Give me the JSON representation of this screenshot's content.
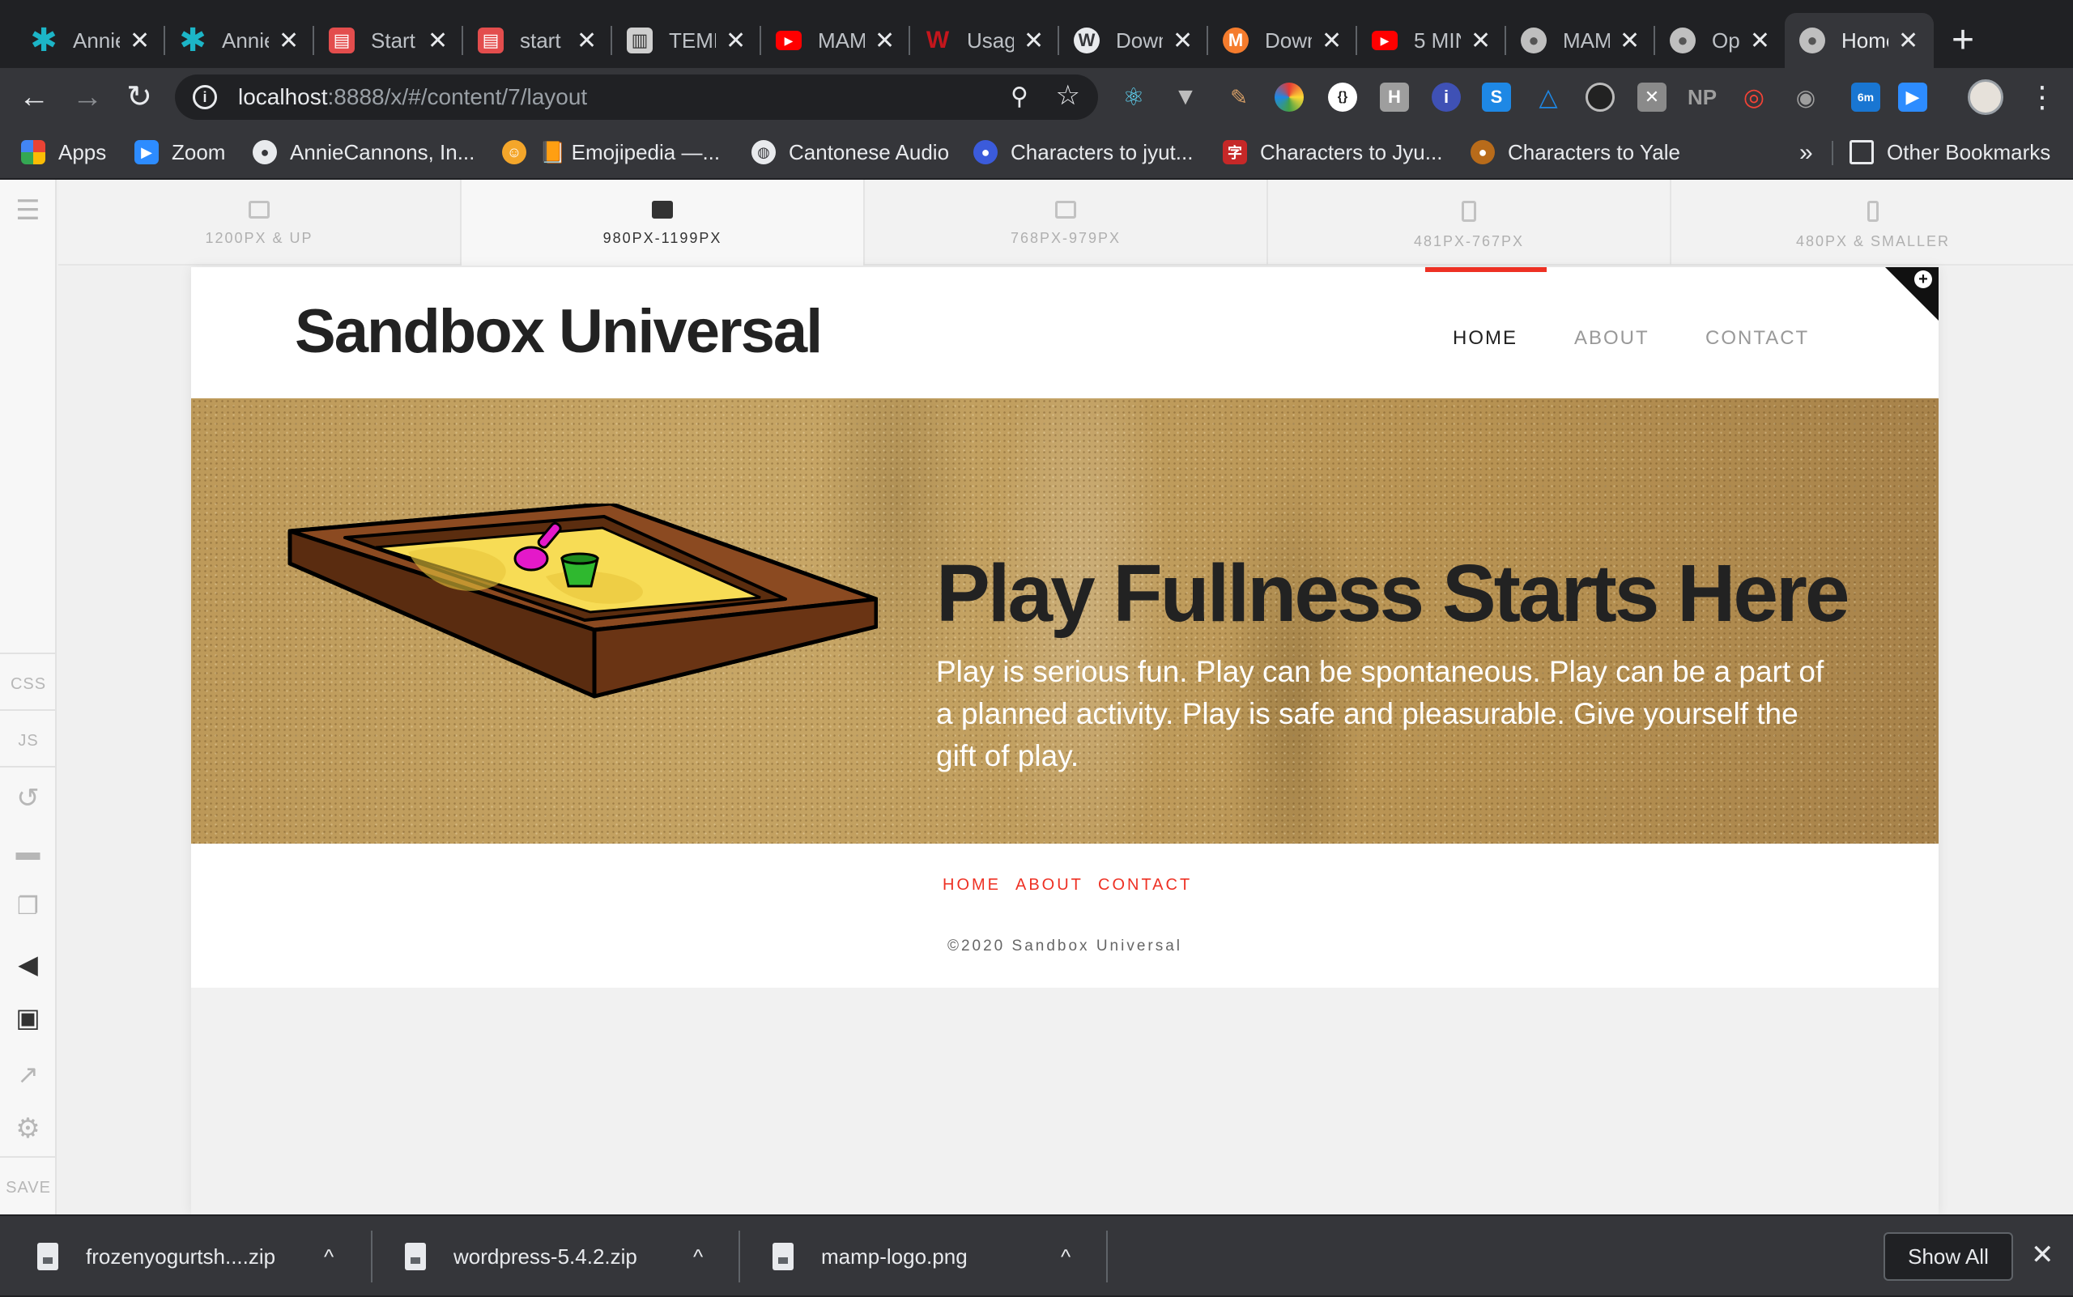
{
  "browser": {
    "tabs": [
      {
        "title": "Annie",
        "icon": "asterisk-icon",
        "color": "#1cb5c7"
      },
      {
        "title": "Annie",
        "icon": "asterisk-icon",
        "color": "#1cb5c7"
      },
      {
        "title": "Start",
        "icon": "clapper-icon",
        "color": "#e34d4d"
      },
      {
        "title": "start",
        "icon": "clapper-icon",
        "color": "#e34d4d"
      },
      {
        "title": "TEMP",
        "icon": "book-icon",
        "color": "#cfcfcf"
      },
      {
        "title": "MAMP",
        "icon": "youtube-icon",
        "color": "#ff0000"
      },
      {
        "title": "Usage",
        "icon": "w-icon",
        "color": "#c4161c"
      },
      {
        "title": "Down",
        "icon": "wordpress-icon",
        "color": "#e8eaed"
      },
      {
        "title": "Down",
        "icon": "m-icon",
        "color": "#f57c2d"
      },
      {
        "title": "5 MIN",
        "icon": "youtube-icon",
        "color": "#ff0000"
      },
      {
        "title": "MAMP",
        "icon": "elephant-icon",
        "color": "#bfbfbf"
      },
      {
        "title": "Option",
        "icon": "elephant-icon",
        "color": "#bfbfbf"
      },
      {
        "title": "Home",
        "icon": "elephant-icon",
        "color": "#bfbfbf"
      }
    ],
    "url_host": "localhost",
    "url_path": ":8888/x/#/content/7/layout",
    "bookmarks": [
      {
        "label": "Apps",
        "icon": "apps-grid-icon",
        "color": "#ea4335"
      },
      {
        "label": "Zoom",
        "icon": "zoom-icon",
        "color": "#2d8cff"
      },
      {
        "label": "AnnieCannons, In...",
        "icon": "github-icon",
        "color": "#e8eaed"
      },
      {
        "label": "📙 Emojipedia —...",
        "icon": "emojipedia-icon",
        "color": "#f4a62a"
      },
      {
        "label": "Cantonese Audio",
        "icon": "globe-icon",
        "color": "#e8eaed"
      },
      {
        "label": "Characters to jyut...",
        "icon": "bookmark-site-icon",
        "color": "#3b5bdb"
      },
      {
        "label": "Characters to Jyu...",
        "icon": "chinese-char-icon",
        "color": "#c62828"
      },
      {
        "label": "Characters to Yale",
        "icon": "character-icon",
        "color": "#b86b1a"
      }
    ],
    "bookmarks_more": "»",
    "other_bookmarks": "Other Bookmarks"
  },
  "editor": {
    "sidebar": {
      "css": "CSS",
      "js": "JS",
      "save": "SAVE"
    },
    "breakpoints": [
      {
        "label": "1200PX & UP",
        "device": "desktop-icon"
      },
      {
        "label": "980PX-1199PX",
        "device": "laptop-icon"
      },
      {
        "label": "768PX-979PX",
        "device": "tablet-landscape-icon"
      },
      {
        "label": "481PX-767PX",
        "device": "tablet-portrait-icon"
      },
      {
        "label": "480PX & SMALLER",
        "device": "phone-icon"
      }
    ],
    "active_breakpoint": "980PX-1199PX"
  },
  "site": {
    "logo": "Sandbox Universal",
    "nav": [
      "HOME",
      "ABOUT",
      "CONTACT"
    ],
    "current_nav": "HOME",
    "hero": {
      "title": "Play Fullness Starts Here",
      "text": "Play is serious fun. Play can be spontaneous. Play can be a part of a planned activity. Play is safe and pleasurable. Give yourself the gift of play."
    },
    "footer_nav": [
      "HOME",
      "ABOUT",
      "CONTACT"
    ],
    "copyright": "©2020 Sandbox Universal",
    "accent": "#ee3124"
  },
  "downloads": {
    "files": [
      "frozenyogurtsh....zip",
      "wordpress-5.4.2.zip",
      "mamp-logo.png"
    ],
    "show_all": "Show All"
  }
}
